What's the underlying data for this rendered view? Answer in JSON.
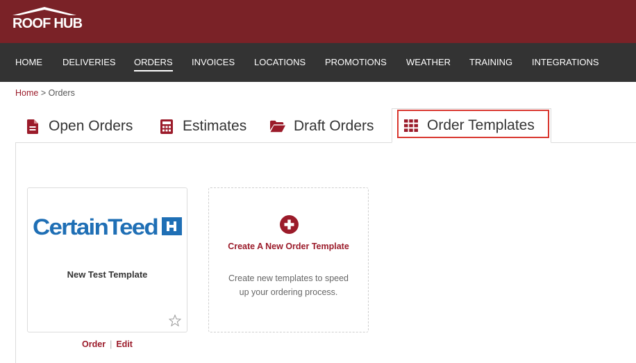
{
  "brand": {
    "logo_text": "ROOF HUB",
    "color_header": "#7a2227",
    "color_nav": "#333333",
    "color_accent": "#9b1b2a",
    "color_highlight": "#d9372f"
  },
  "nav": {
    "items": [
      {
        "label": "HOME"
      },
      {
        "label": "DELIVERIES"
      },
      {
        "label": "ORDERS",
        "active": true
      },
      {
        "label": "INVOICES"
      },
      {
        "label": "LOCATIONS"
      },
      {
        "label": "PROMOTIONS"
      },
      {
        "label": "WEATHER"
      },
      {
        "label": "TRAINING"
      },
      {
        "label": "INTEGRATIONS"
      }
    ]
  },
  "breadcrumb": {
    "home": "Home",
    "separator": ">",
    "current": "Orders"
  },
  "tabs": [
    {
      "label": "Open Orders",
      "icon": "document-icon"
    },
    {
      "label": "Estimates",
      "icon": "calculator-icon"
    },
    {
      "label": "Draft Orders",
      "icon": "folder-open-icon"
    },
    {
      "label": "Order Templates",
      "icon": "grid-icon",
      "active": true
    }
  ],
  "templates": [
    {
      "brand_logo": "CertainTeed",
      "title": "New Test Template",
      "favorite": false,
      "actions": {
        "order": "Order",
        "separator": "|",
        "edit": "Edit"
      }
    }
  ],
  "new_template": {
    "title": "Create A New Order Template",
    "description": "Create new templates to speed up your ordering process.",
    "icon": "plus-circle-icon"
  }
}
